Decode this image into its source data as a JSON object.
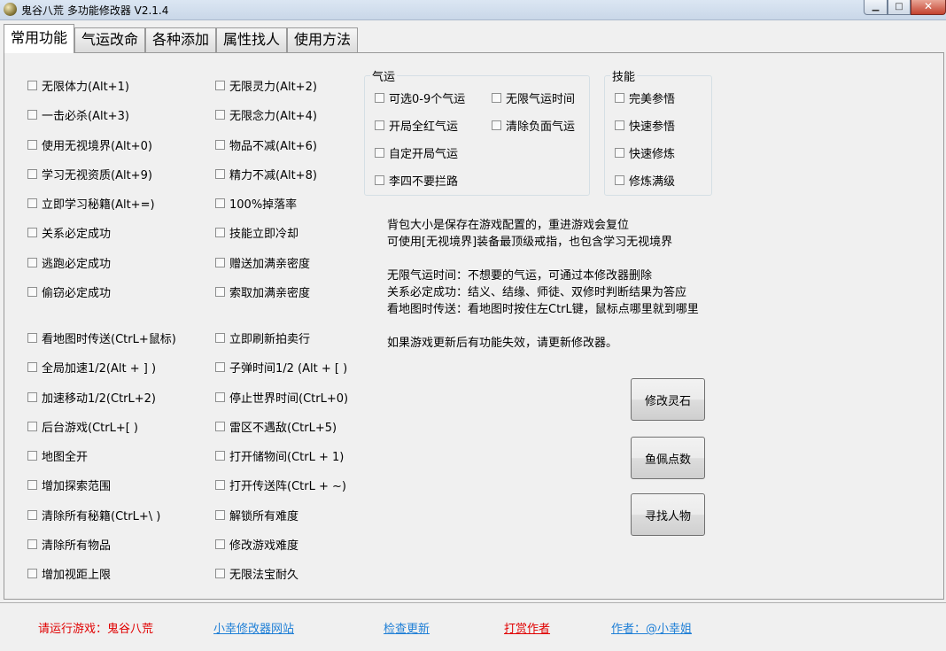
{
  "window": {
    "title": "鬼谷八荒 多功能修改器  V2.1.4",
    "min": "▁",
    "max": "□",
    "close": "✕"
  },
  "tabs": [
    {
      "label": "常用功能",
      "active": true
    },
    {
      "label": "气运改命",
      "active": false
    },
    {
      "label": "各种添加",
      "active": false
    },
    {
      "label": "属性找人",
      "active": false
    },
    {
      "label": "使用方法",
      "active": false
    }
  ],
  "col1": [
    "无限体力(Alt+1)",
    "一击必杀(Alt+3)",
    "使用无视境界(Alt+0)",
    "学习无视资质(Alt+9)",
    "立即学习秘籍(Alt+=)",
    "关系必定成功",
    "逃跑必定成功",
    "偷窃必定成功",
    "看地图时传送(CtrL+鼠标)",
    "全局加速1/2(Alt + ] )",
    "加速移动1/2(CtrL+2)",
    "后台游戏(CtrL+[ )",
    "地图全开",
    "增加探索范围",
    "清除所有秘籍(CtrL+\\ )",
    "清除所有物品",
    "增加视距上限"
  ],
  "col2": [
    "无限灵力(Alt+2)",
    "无限念力(Alt+4)",
    "物品不减(Alt+6)",
    "精力不减(Alt+8)",
    "100%掉落率",
    "技能立即冷却",
    "赠送加满亲密度",
    "索取加满亲密度",
    "立即刷新拍卖行",
    "子弹时间1/2 (Alt + [ )",
    "停止世界时间(CtrL+0)",
    "雷区不遇敌(CtrL+5)",
    "打开储物间(CtrL + 1)",
    "打开传送阵(CtrL + ~)",
    "解锁所有难度",
    "修改游戏难度",
    "无限法宝耐久"
  ],
  "luck_group": {
    "title": "气运",
    "items": [
      "可选0-9个气运",
      "无限气运时间",
      "开局全红气运",
      "清除负面气运",
      "自定开局气运",
      "李四不要拦路"
    ]
  },
  "skill_group": {
    "title": "技能",
    "items": [
      "完美参悟",
      "快速参悟",
      "快速修炼",
      "修炼满级"
    ]
  },
  "info_lines": [
    "背包大小是保存在游戏配置的，重进游戏会复位",
    "可使用[无视境界]装备最顶级戒指，也包含学习无视境界",
    "无限气运时间：不想要的气运，可通过本修改器删除",
    "关系必定成功：结义、结缘、师徒、双修时判断结果为答应",
    "看地图时传送：看地图时按住左CtrL键，鼠标点哪里就到哪里",
    "如果游戏更新后有功能失效，请更新修改器。"
  ],
  "buttons": [
    "修改灵石",
    "鱼佩点数",
    "寻找人物"
  ],
  "footer": {
    "status": "请运行游戏：鬼谷八荒",
    "site": "小幸修改器网站",
    "update": "检查更新",
    "donate": "打赏作者",
    "author": "作者：@小幸姐"
  }
}
